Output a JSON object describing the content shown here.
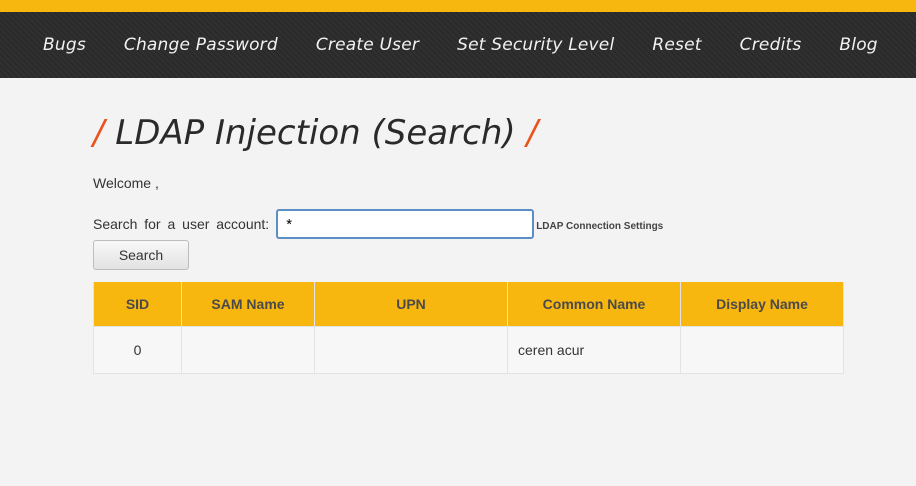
{
  "nav": {
    "items": [
      {
        "label": "Bugs"
      },
      {
        "label": "Change Password"
      },
      {
        "label": "Create User"
      },
      {
        "label": "Set Security Level"
      },
      {
        "label": "Reset"
      },
      {
        "label": "Credits"
      },
      {
        "label": "Blog"
      }
    ]
  },
  "page": {
    "title": "LDAP Injection (Search)",
    "title_slash": "/",
    "welcome": "Welcome ,"
  },
  "search": {
    "label": "Search for a user account:",
    "value": "*",
    "ldap_link": "LDAP Connection Settings",
    "button_label": "Search"
  },
  "table": {
    "headers": [
      "SID",
      "SAM Name",
      "UPN",
      "Common Name",
      "Display Name"
    ],
    "rows": [
      [
        "0",
        "",
        "",
        "ceren acur",
        ""
      ]
    ]
  },
  "colors": {
    "accent": "#f7b70f",
    "slash": "#e8541b",
    "navbar": "#2c2c2c"
  }
}
